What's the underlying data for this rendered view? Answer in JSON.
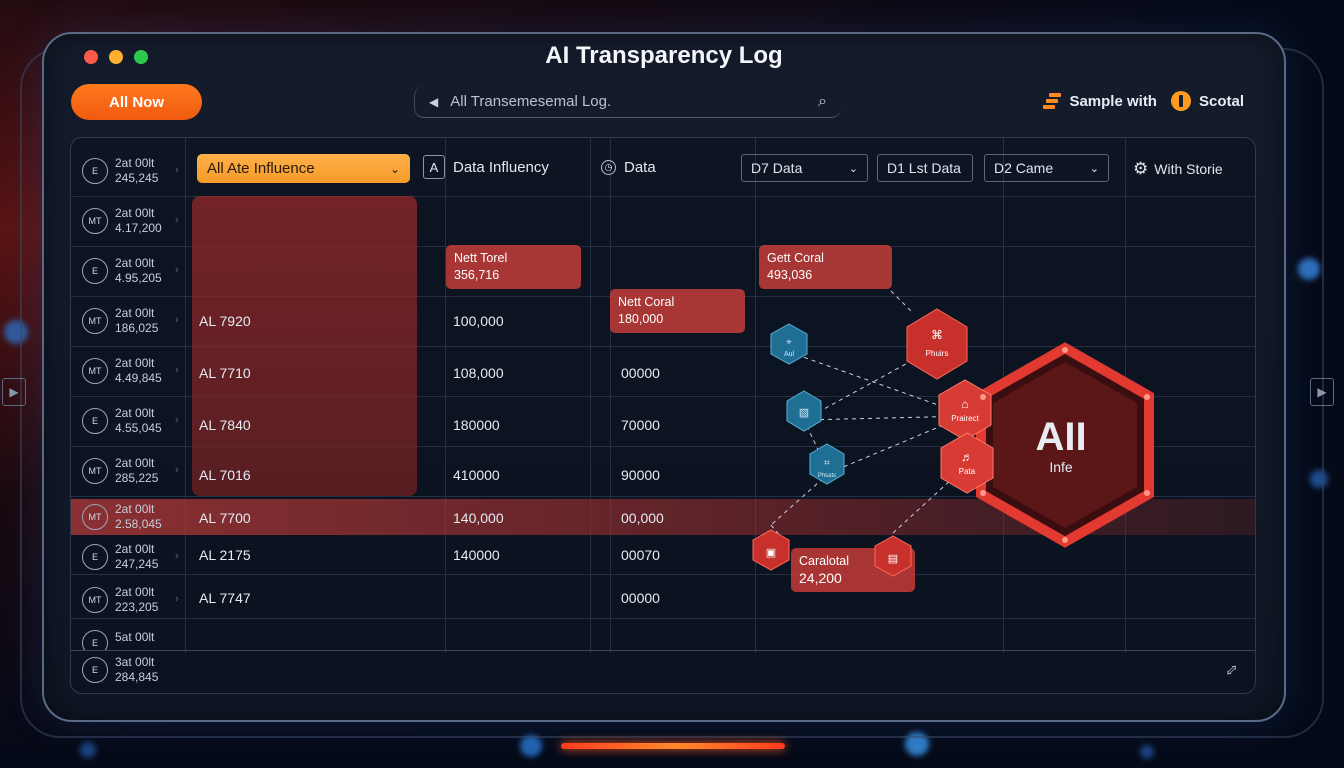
{
  "window": {
    "title": "AI Transparency Log",
    "controls": [
      "close",
      "minimize",
      "maximize"
    ]
  },
  "toolbar": {
    "primary_button": "All Now",
    "search_placeholder": "All Transemesemal Log.",
    "sample_label": "Sample with",
    "scotal_label": "Scotal"
  },
  "filters": {
    "main_dropdown": "All Ate Influence",
    "column_a_letter": "A",
    "column_a_label": "Data Influency",
    "column_b_label": "Data",
    "select_1": "D7 Data",
    "select_2": "D1 Lst Data",
    "select_3": "D2 Came",
    "settings_label": "With Storie"
  },
  "sidebar": [
    {
      "avatar": "E",
      "line1": "2at 00lt",
      "line2": "245,245"
    },
    {
      "avatar": "MT",
      "line1": "2at 00lt",
      "line2": "4.17,200"
    },
    {
      "avatar": "E",
      "line1": "2at 00lt",
      "line2": "4.95,205"
    },
    {
      "avatar": "MT",
      "line1": "2at 00lt",
      "line2": "186,025"
    },
    {
      "avatar": "MT",
      "line1": "2at 00lt",
      "line2": "4.49,845"
    },
    {
      "avatar": "E",
      "line1": "2at 00lt",
      "line2": "4.55,045"
    },
    {
      "avatar": "MT",
      "line1": "2at 00lt",
      "line2": "285,225"
    },
    {
      "avatar": "MT",
      "line1": "2at 00lt",
      "line2": "2.58,045"
    },
    {
      "avatar": "E",
      "line1": "2at 00lt",
      "line2": "247,245"
    },
    {
      "avatar": "MT",
      "line1": "2at 00lt",
      "line2": "223,205"
    },
    {
      "avatar": "E",
      "line1": "5at 00lt",
      "line2": ""
    },
    {
      "avatar": "E",
      "line1": "3at 00lt",
      "line2": "284,845"
    }
  ],
  "rows": [
    {
      "id": "AL 7920",
      "influence": "100,000",
      "data": ""
    },
    {
      "id": "AL 7710",
      "influence": "108,000",
      "data": "00000"
    },
    {
      "id": "AL 7840",
      "influence": "180000",
      "data": "70000"
    },
    {
      "id": "AL 7016",
      "influence": "410000",
      "data": "90000"
    },
    {
      "id": "AL 7700",
      "influence": "140,000",
      "data": "00,000"
    },
    {
      "id": "AL 2175",
      "influence": "140000",
      "data": "00070"
    },
    {
      "id": "AL 7747",
      "influence": "",
      "data": "00000"
    }
  ],
  "tooltips": [
    {
      "title": "Nett Torel",
      "value": "356,716"
    },
    {
      "title": "Nett Coral",
      "value": "180,000"
    },
    {
      "title": "Gett Coral",
      "value": "493,036"
    },
    {
      "title": "Caralotal",
      "value": "24,200"
    }
  ],
  "graph": {
    "hub_title": "AII",
    "hub_subtitle": "Infe",
    "node_labels": [
      "Aul",
      "Phuirs",
      "Prairect",
      "Pata",
      "Phsats"
    ],
    "colors": {
      "red": "#d63a32",
      "blue": "#1f6f94",
      "accent": "#ff7a1e"
    }
  }
}
